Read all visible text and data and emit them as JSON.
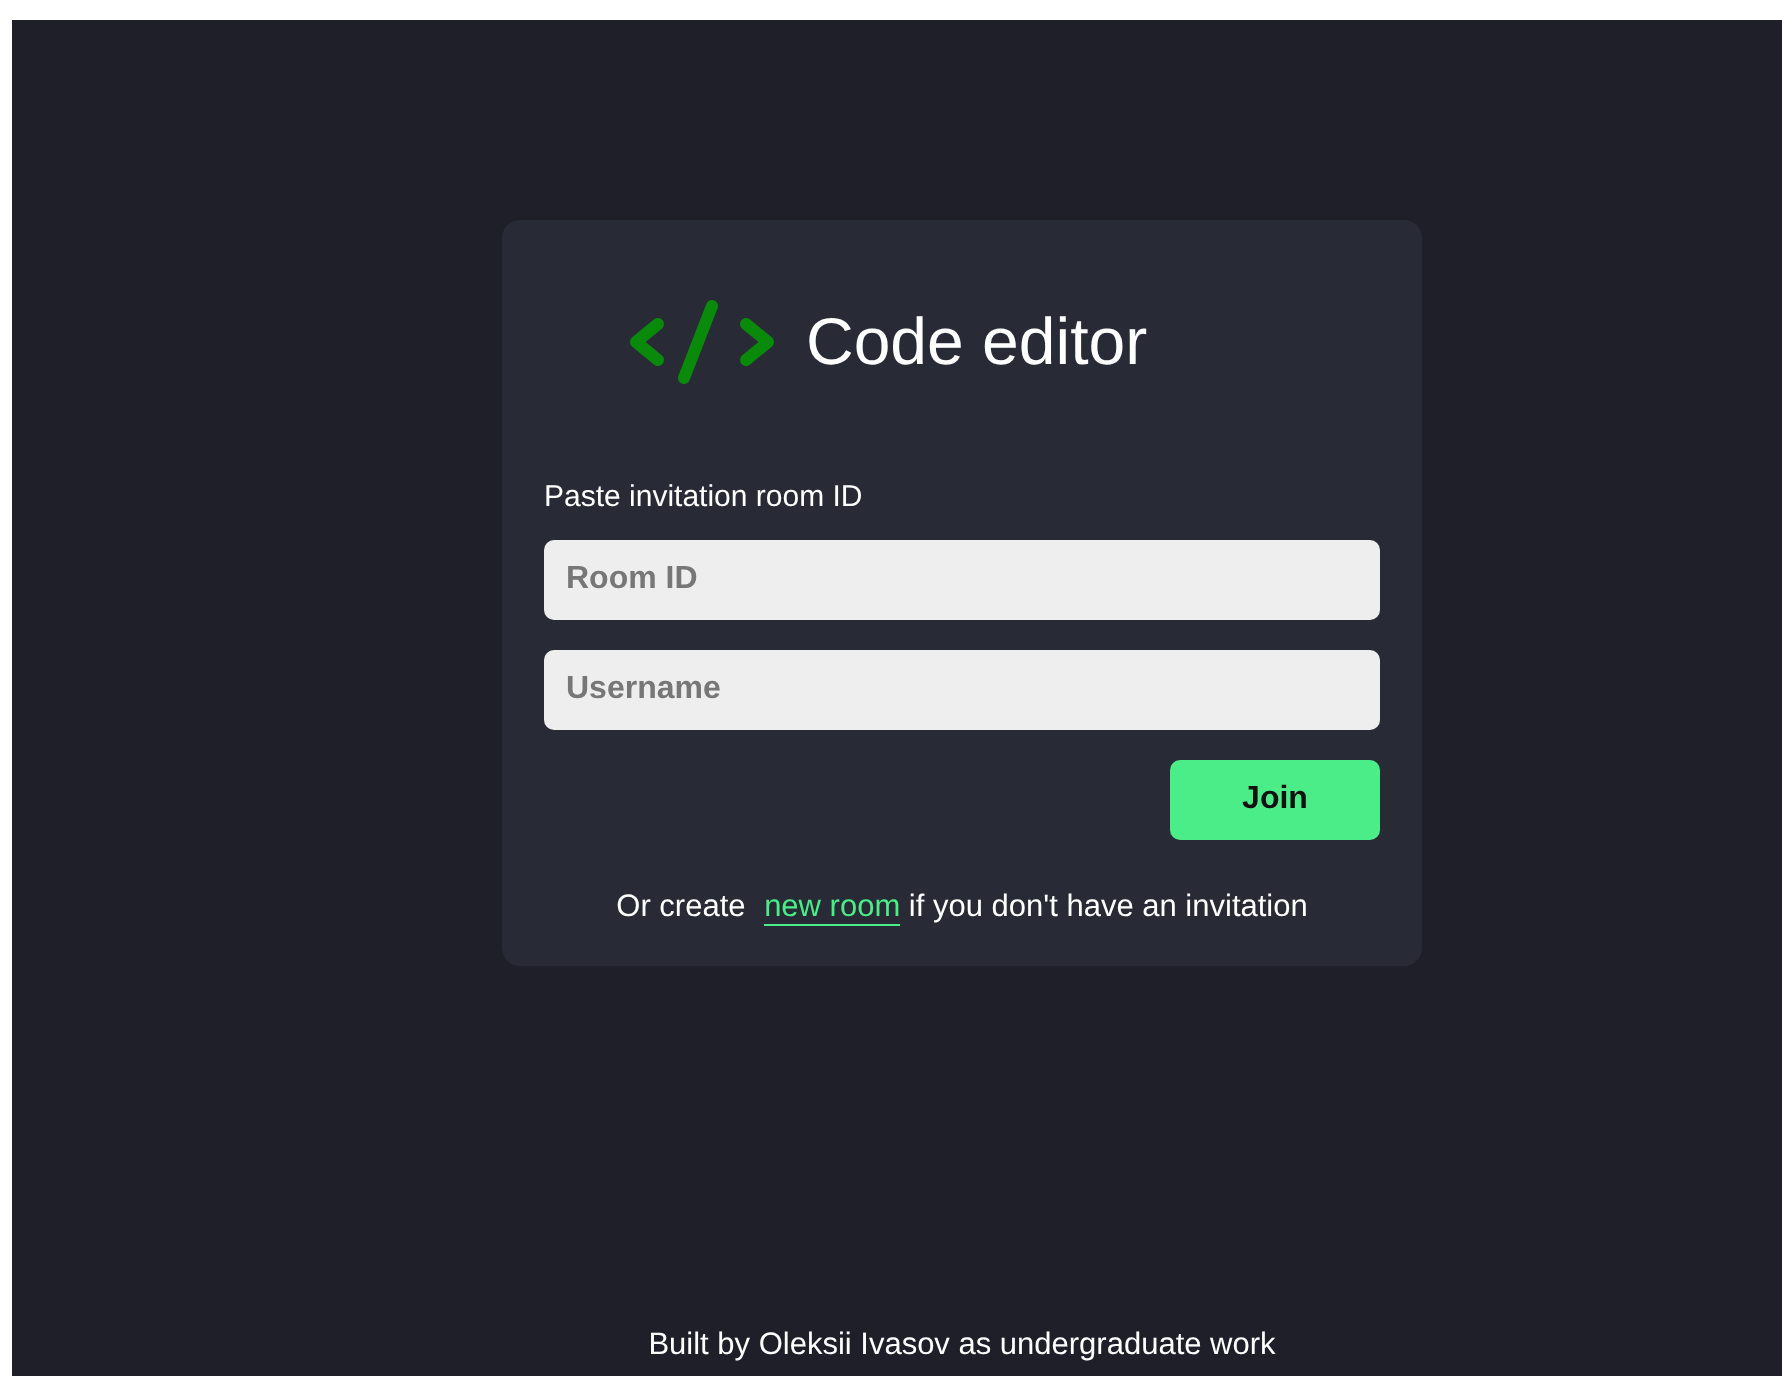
{
  "logo": {
    "title": "Code editor"
  },
  "form": {
    "label": "Paste invitation room ID",
    "fields": [
      {
        "placeholder": "Room ID"
      },
      {
        "placeholder": "Username"
      }
    ],
    "button": "Join"
  },
  "invite_note": {
    "before": "Or create ",
    "link": "new room",
    "after": " if you don't have an invitation"
  },
  "footer": "Built by Oleksii Ivasov as undergraduate work"
}
